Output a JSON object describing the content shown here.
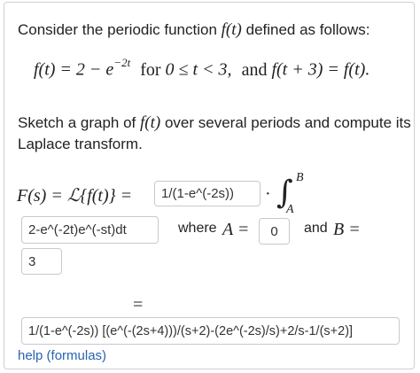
{
  "problem": {
    "intro": "Consider the periodic function",
    "intro_func": "f(t)",
    "intro_tail": "defined as follows:",
    "definition": {
      "lhs": "f(t) = 2 − e",
      "exp": "−2t",
      "for_word": "for",
      "range": "0 ≤ t < 3,",
      "and_word": "and",
      "periodicity": "f(t + 3) = f(t)."
    },
    "task_line1": "Sketch a graph of",
    "task_func": "f(t)",
    "task_line1_tail": "over several periods and compute its",
    "task_line2": "Laplace transform."
  },
  "equation": {
    "lhs": "F(s) = ℒ{f(t)} =",
    "dot": "·",
    "integral_symbol": "∫",
    "upper_limit": "B",
    "lower_limit": "A",
    "where_word": "where",
    "a_label": "A =",
    "and_word": "and",
    "b_label": "B =",
    "equals": "="
  },
  "inputs": {
    "factor": "1/(1-e^(-2s))",
    "integrand": "2-e^(-2t)e^(-st)dt",
    "lower": "0",
    "upper": "3",
    "final": "1/(1-e^(-2s)) [(e^(-(2s+4)))/(s+2)-(2e^(-2s)/s)+2/s-1/(s+2)]"
  },
  "help_link": "help (formulas)"
}
